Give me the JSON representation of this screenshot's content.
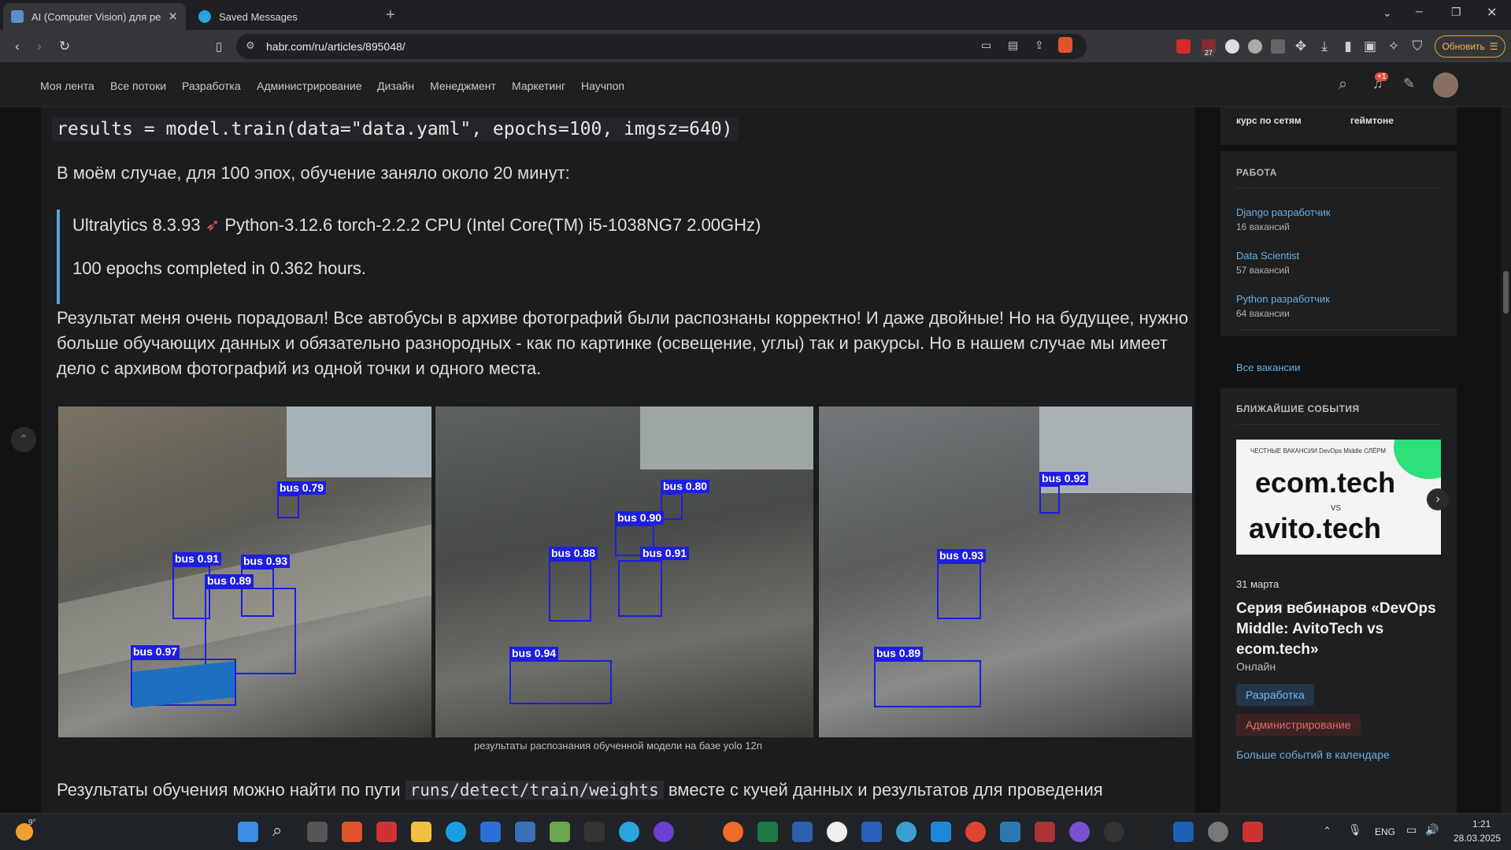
{
  "tabs": [
    {
      "title": "AI (Computer Vision) для реал",
      "favicon_color": "#5a8fc7",
      "active": true
    },
    {
      "title": "Saved Messages",
      "favicon_color": "#2aa3e0",
      "active": false
    }
  ],
  "toolbar": {
    "url": "habr.com/ru/articles/895048/",
    "update_label": "Обновить",
    "badge": "27"
  },
  "habr": {
    "nav": [
      "Моя лента",
      "Все потоки",
      "Разработка",
      "Администрирование",
      "Дизайн",
      "Менеджмент",
      "Маркетинг",
      "Научпоп"
    ],
    "notif_badge": "+1"
  },
  "article": {
    "code1": "results = model.train(data=\"data.yaml\", epochs=100, imgsz=640)",
    "para1": "В моём случае, для 100 эпох, обучение заняло около 20 минут:",
    "quote1_a": "Ultralytics 8.3.93",
    "quote1_b": "Python-3.12.6 torch-2.2.2 CPU (Intel Core(TM) i5-1038NG7 2.00GHz)",
    "quote2": "100 epochs completed in 0.362 hours.",
    "para2": "Результат меня очень порадовал! Все автобусы в архиве фотографий были распознаны корректно! И даже двойные! Но на будущее, нужно больше обучающих данных и обязательно разнородных - как по картинке (освещение, углы) так и ракурсы. Но в нашем случае мы имеет дело с архивом фотографий из одной точки и одного места.",
    "caption": "результаты распознания обученной модели на базе yolo 12n",
    "para3_a": "Результаты обучения можно найти по пути",
    "para3_code": "runs/detect/train/weights",
    "para3_b": "вместе с кучей данных и результатов для проведения",
    "detections": [
      [
        "bus 0.79",
        "bus 0.91",
        "bus 0.93",
        "bus 0.89",
        "bus 0.97"
      ],
      [
        "bus 0.80",
        "bus 0.90",
        "bus 0.88",
        "bus 0.91",
        "bus 0.94"
      ],
      [
        "bus 0.92",
        "bus 0.93",
        "bus 0.89"
      ]
    ]
  },
  "sidebar": {
    "top_left": "курс по сетям",
    "top_right": "геймтоне",
    "jobs_title": "РАБОТА",
    "jobs": [
      {
        "title": "Django разработчик",
        "count": "16 вакансий"
      },
      {
        "title": "Data Scientist",
        "count": "57 вакансий"
      },
      {
        "title": "Python разработчик",
        "count": "64 вакансии"
      }
    ],
    "all_jobs": "Все вакансии",
    "events_title": "БЛИЖАЙШИЕ СОБЫТИЯ",
    "banner_line1": "ecom.tech",
    "banner_vs": "vs",
    "banner_line2": "avito.tech",
    "banner_small": "ЧЕСТНЫЕ ВАКАНСИИ DevOps Middle СЛЁРМ",
    "event_date": "31 марта",
    "event_title": "Серия вебинаров «DevOps Middle: AvitoTech vs ecom.tech»",
    "event_format": "Онлайн",
    "tag1": "Разработка",
    "tag2": "Администрирование",
    "more_events": "Больше событий в календаре"
  },
  "taskbar": {
    "weather": "9°",
    "lang": "ENG",
    "time": "1:21",
    "date": "28.03.2025"
  }
}
